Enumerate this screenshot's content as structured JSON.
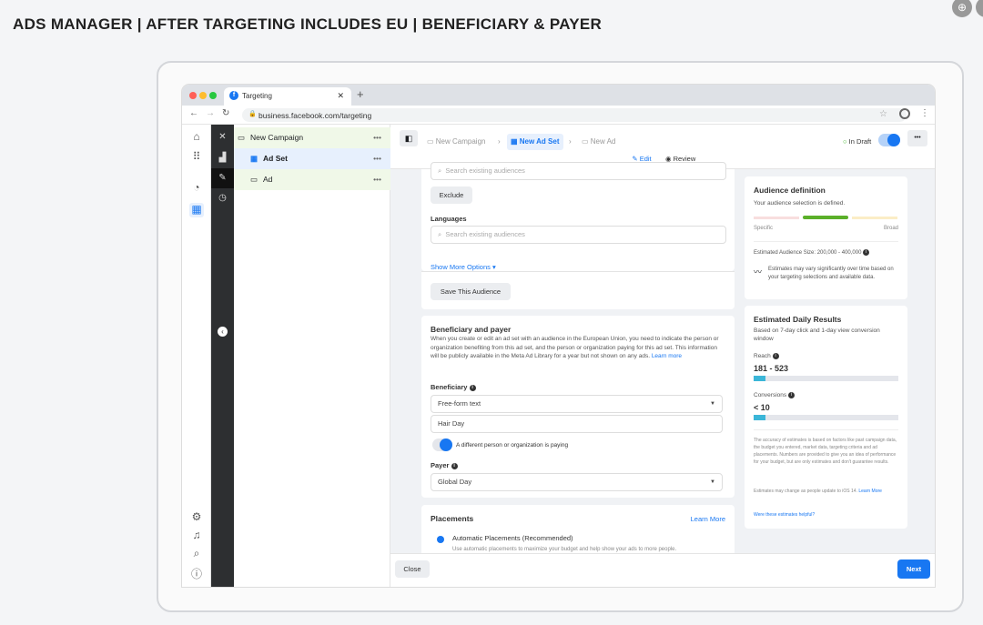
{
  "page_title": "ADS MANAGER | AFTER TARGETING INCLUDES EU | BENEFICIARY & PAYER",
  "browser": {
    "tab_title": "Targeting",
    "url": "business.facebook.com/targeting"
  },
  "tree": {
    "campaign": "New Campaign",
    "adset": "Ad Set",
    "ad": "Ad",
    "more": "•••"
  },
  "header": {
    "breadcrumb": [
      "New Campaign",
      "New Ad Set",
      "New Ad"
    ],
    "status": "In Draft",
    "tabs": {
      "edit": "Edit",
      "review": "Review"
    },
    "more": "•••"
  },
  "form": {
    "search_placeholder": "Search existing audiences",
    "exclude": "Exclude",
    "languages_label": "Languages",
    "languages_placeholder": "Search existing audiences",
    "show_more": "Show More Options ▾",
    "save_audience": "Save This Audience",
    "beneficiary_title": "Beneficiary and payer",
    "beneficiary_desc": "When you create or edit an ad set with an audience in the European Union, you need to indicate the person or organization benefiting from this ad set, and the person or organization paying for this ad set. This information will be publicly available in the Meta Ad Library for a year but not shown on any ads.",
    "learn_more": "Learn more",
    "beneficiary_label": "Beneficiary",
    "beneficiary_select": "Free-form text",
    "beneficiary_value": "Hair Day",
    "toggle_label": "A different person or organization is paying",
    "payer_label": "Payer",
    "payer_select": "Global Day",
    "placements_title": "Placements",
    "placements_learn": "Learn More",
    "auto_placements": "Automatic Placements (Recommended)",
    "auto_desc": "Use automatic placements to maximize your budget and help show your ads to more people."
  },
  "audience": {
    "title": "Audience definition",
    "subtitle": "Your audience selection is defined.",
    "specific": "Specific",
    "broad": "Broad",
    "size": "Estimated Audience Size: 200,000 - 400,000",
    "note": "Estimates may vary significantly over time based on your targeting selections and available data."
  },
  "results": {
    "title": "Estimated Daily Results",
    "subtitle": "Based on 7-day click and 1-day view conversion window",
    "reach_label": "Reach",
    "reach_value": "181 - 523",
    "reach_fill": 0.08,
    "conv_label": "Conversions",
    "conv_value": "< 10",
    "conv_fill": 0.08,
    "disclaimer": "The accuracy of estimates is based on factors like past campaign data, the budget you entered, market data, targeting criteria and ad placements. Numbers are provided to give you an idea of performance for your budget, but are only estimates and don't guarantee results.",
    "ios_note": "Estimates may change as people update to iOS 14.",
    "ios_learn": "Learn More",
    "helpful": "Were these estimates helpful?"
  },
  "footer": {
    "close": "Close",
    "next": "Next"
  },
  "colors": {
    "accent": "#1877f2",
    "green": "#5bb02a",
    "teal": "#3bb6d8"
  }
}
